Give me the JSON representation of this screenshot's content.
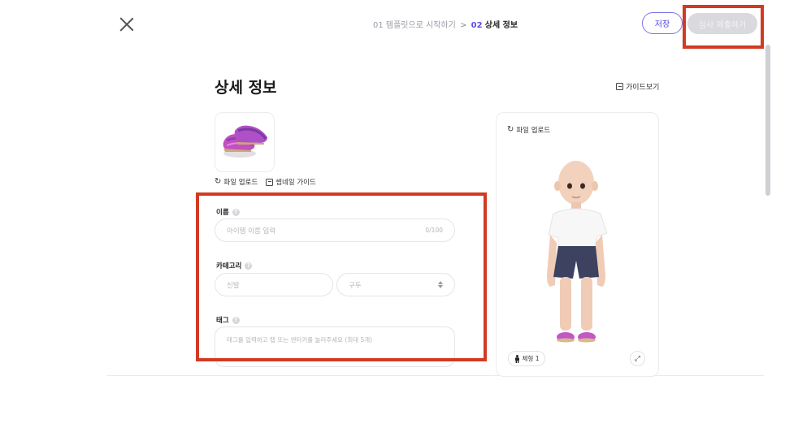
{
  "header": {
    "breadcrumb": {
      "step1": "01 템플릿으로 시작하기",
      "separator": ">",
      "step2_num": "02",
      "step2_label": "상세 정보"
    },
    "save_label": "저장",
    "submit_label": "심사 제출하기"
  },
  "main": {
    "title": "상세 정보",
    "guide_label": "가이드보기",
    "thumbnail": {
      "upload_label": "파일 업로드",
      "guide_label": "썸네일 가이드"
    },
    "form": {
      "name": {
        "label": "이름",
        "placeholder": "아이템 이름 입력",
        "counter": "0/100"
      },
      "category": {
        "label": "카테고리",
        "primary_value": "신발",
        "secondary_value": "구두"
      },
      "tags": {
        "label": "태그",
        "placeholder": "태그를 입력하고 탭 또는 엔터키를 눌러주세요 (최대 5개)"
      }
    }
  },
  "preview": {
    "upload_label": "파일 업로드",
    "body_type_label": "체형 1"
  },
  "colors": {
    "accent": "#5b4ee6",
    "highlight": "#d23a22",
    "disabled_button": "#d9d9de"
  },
  "icons": [
    "close-icon",
    "refresh-icon",
    "guide-icon",
    "help-icon",
    "select-arrows-icon",
    "person-icon",
    "expand-icon"
  ]
}
